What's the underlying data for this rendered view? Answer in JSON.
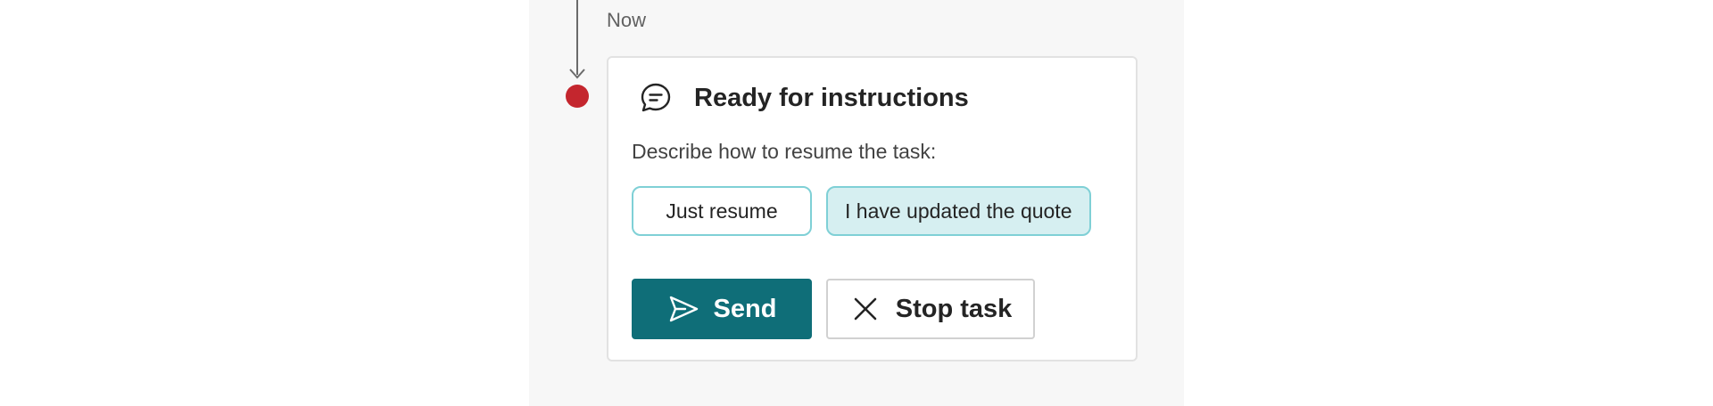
{
  "timeline": {
    "time_label": "Now"
  },
  "card": {
    "icon": "chat-bubble-icon",
    "title": "Ready for instructions",
    "description": "Describe how to resume the task:",
    "suggestions": [
      {
        "label": "Just resume",
        "selected": false
      },
      {
        "label": "I have updated the quote",
        "selected": true
      }
    ],
    "send_button": {
      "label": "Send",
      "icon": "send-icon"
    },
    "stop_button": {
      "label": "Stop task",
      "icon": "close-icon"
    }
  },
  "colors": {
    "accent": "#0f6e78",
    "status_dot": "#c4262e",
    "chip_border": "#7fd0d6",
    "chip_selected_bg": "#d6eff1"
  }
}
